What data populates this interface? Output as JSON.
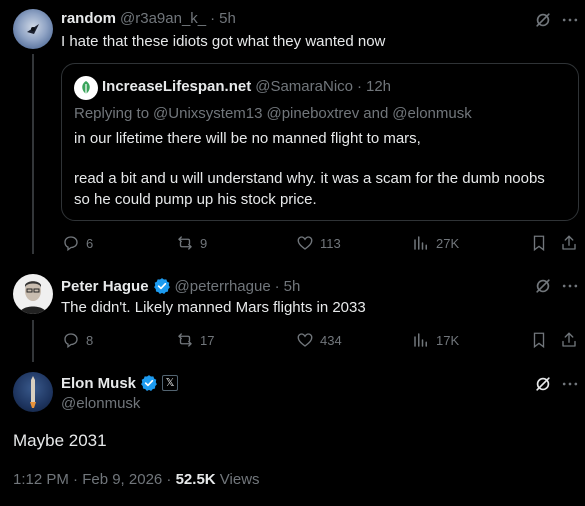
{
  "tweet1": {
    "display_name": "random",
    "handle": "@r3a9an_k_",
    "separator": "·",
    "time": "5h",
    "text": "I hate that these idiots got what they wanted now",
    "quote": {
      "display_name": "IncreaseLifespan.net",
      "handle": "@SamaraNico",
      "separator": "·",
      "time": "12h",
      "replying_prefix": "Replying to ",
      "replying_to": [
        "@Unixsystem13",
        "@pineboxtrev",
        "and",
        "@elonmusk"
      ],
      "line1": "in our lifetime there will be no manned flight to mars,",
      "line2": "read a bit and u will understand why. it was a scam for the dumb noobs",
      "line3": "so he could pump up his stock price."
    },
    "replies": "6",
    "reposts": "9",
    "likes": "113",
    "views": "27K"
  },
  "tweet2": {
    "display_name": "Peter Hague",
    "handle": "@peterrhague",
    "separator": "·",
    "time": "5h",
    "text": "The didn't. Likely manned Mars flights in 2033",
    "replies": "8",
    "reposts": "17",
    "likes": "434",
    "views": "17K"
  },
  "tweet3": {
    "display_name": "Elon Musk",
    "handle": "@elonmusk",
    "affiliate_badge": "𝕏",
    "text": "Maybe 2031",
    "timestamp": "1:12 PM · Feb 9, 2026 · ",
    "views_count": "52.5K",
    "views_label": " Views"
  },
  "colors": {
    "background": "#000000",
    "text": "#e7e9ea",
    "muted": "#71767b",
    "verified": "#1d9bf0",
    "border": "#2f3336"
  },
  "icons": [
    "grok-icon",
    "more-icon",
    "reply-icon",
    "repost-icon",
    "like-icon",
    "views-icon",
    "bookmark-icon",
    "share-icon",
    "verified-badge-icon"
  ]
}
